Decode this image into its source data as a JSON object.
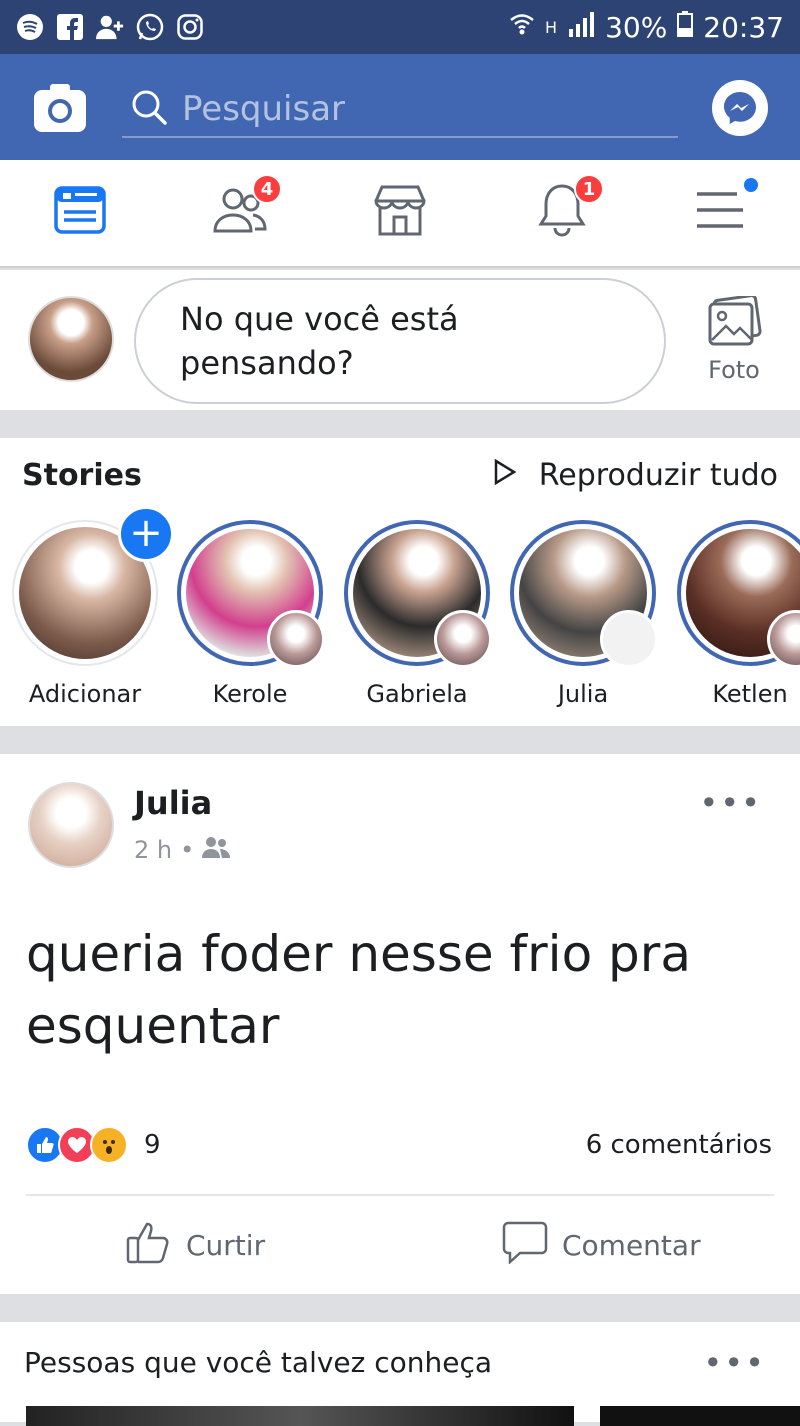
{
  "status_bar": {
    "battery": "30%",
    "time": "20:37",
    "network_label": "H"
  },
  "search": {
    "placeholder": "Pesquisar"
  },
  "nav": {
    "friends_badge": "4",
    "notifications_badge": "1"
  },
  "composer": {
    "placeholder": "No que você está pensando?",
    "photo_label": "Foto"
  },
  "stories": {
    "title": "Stories",
    "play_all": "Reproduzir tudo",
    "items": [
      {
        "name": "Adicionar"
      },
      {
        "name": "Kerole"
      },
      {
        "name": "Gabriela"
      },
      {
        "name": "Julia"
      },
      {
        "name": "Ketlen"
      }
    ]
  },
  "post": {
    "author": "Julia",
    "time": "2 h",
    "text": "queria foder nesse frio pra esquentar",
    "reaction_count": "9",
    "comments": "6 comentários",
    "like_label": "Curtir",
    "comment_label": "Comentar"
  },
  "pymk": {
    "title": "Pessoas que você talvez conheça"
  },
  "colors": {
    "brand": "#4267b2",
    "status_bar": "#2d4373",
    "badge": "#fa3e3e"
  }
}
